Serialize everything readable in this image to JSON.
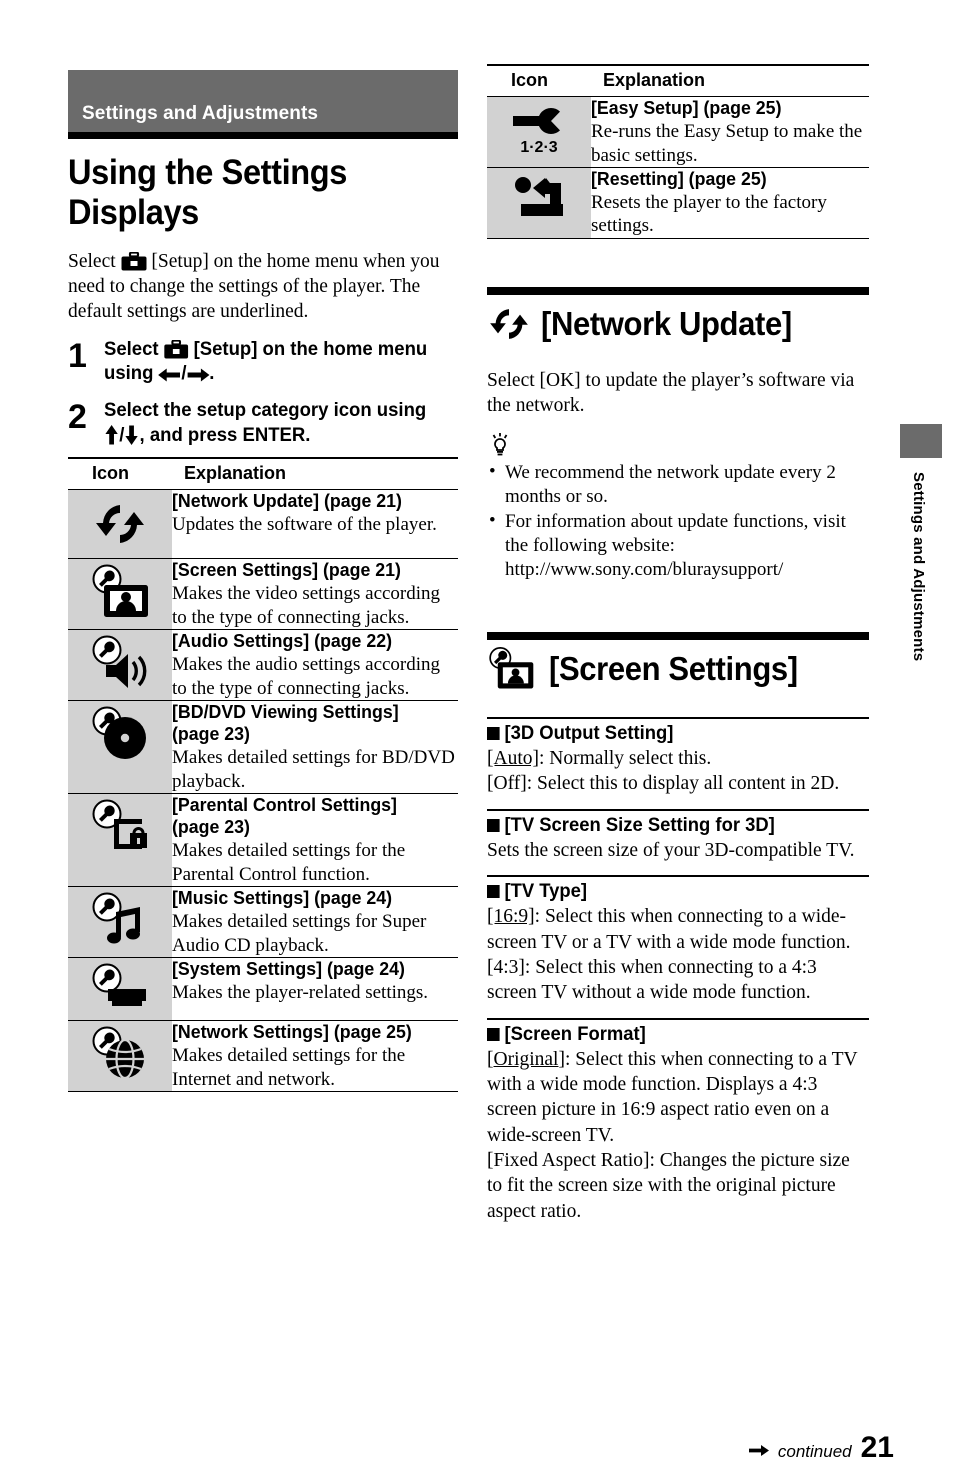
{
  "chapter": {
    "label": "Settings and Adjustments"
  },
  "headline": "Using the Settings Displays",
  "intro": {
    "before_icon": "Select",
    "after_icon": "[Setup] on the home menu when you need to change the settings of the player. The default settings are underlined."
  },
  "steps": [
    {
      "num": "1",
      "before_icon": "Select",
      "after_icon": "[Setup] on the home menu using",
      "after_arrows": "."
    },
    {
      "num": "2",
      "before_icon": "Select the setup category icon using",
      "after_arrows": ", and press ENTER."
    }
  ],
  "table": {
    "headers": {
      "icon": "Icon",
      "explanation": "Explanation"
    },
    "left_rows": [
      {
        "icon": "network-update-icon",
        "title": "[Network Update] (page 21)",
        "desc": "Updates the software of the player."
      },
      {
        "icon": "screen-settings-icon",
        "title": "[Screen Settings] (page 21)",
        "desc": "Makes the video settings according to the type of connecting jacks."
      },
      {
        "icon": "audio-settings-icon",
        "title": "[Audio Settings] (page 22)",
        "desc": "Makes the audio settings according to the type of connecting jacks."
      },
      {
        "icon": "bd-dvd-viewing-settings-icon",
        "title": "[BD/DVD Viewing Settings] (page 23)",
        "desc": "Makes detailed settings for BD/DVD playback."
      },
      {
        "icon": "parental-control-settings-icon",
        "title": "[Parental Control Settings] (page 23)",
        "desc": "Makes detailed settings for the Parental Control function."
      },
      {
        "icon": "music-settings-icon",
        "title": "[Music Settings] (page 24)",
        "desc": "Makes detailed settings for Super Audio CD playback."
      },
      {
        "icon": "system-settings-icon",
        "title": "[System Settings] (page 24)",
        "desc": "Makes the player-related settings."
      },
      {
        "icon": "network-settings-icon",
        "title": "[Network Settings] (page 25)",
        "desc": "Makes detailed settings for the Internet and network."
      }
    ],
    "right_rows": [
      {
        "icon": "easy-setup-icon",
        "title": "[Easy Setup] (page 25)",
        "desc": "Re-runs the Easy Setup to make the basic settings."
      },
      {
        "icon": "resetting-icon",
        "title": "[Resetting] (page 25)",
        "desc": "Resets the player to the factory settings."
      }
    ]
  },
  "network_update": {
    "title": "[Network Update]",
    "icon": "network-update-icon",
    "body": "Select [OK] to update the player’s software via the network.",
    "tips": [
      "We recommend the network update every 2 months or so.",
      "For information about update functions, visit the following website:",
      "http://www.sony.com/bluraysupport/"
    ]
  },
  "screen_settings": {
    "title": "[Screen Settings]",
    "icon": "screen-settings-icon",
    "subsections": [
      {
        "head": "[3D Output Setting]",
        "lines": [
          {
            "option": "[Auto]",
            "underline": true,
            "text": ": Normally select this."
          },
          {
            "option": "[Off]",
            "underline": false,
            "text": ": Select this to display all content in 2D."
          }
        ]
      },
      {
        "head": "[TV Screen Size Setting for 3D]",
        "lines": [
          {
            "option": "",
            "underline": false,
            "text": "Sets the screen size of your 3D-compatible TV."
          }
        ]
      },
      {
        "head": "[TV Type]",
        "lines": [
          {
            "option": "[16:9]",
            "underline": true,
            "text": ": Select this when connecting to a wide-screen TV or a TV with a wide mode function."
          },
          {
            "option": "[4:3]",
            "underline": false,
            "text": ": Select this when connecting to a 4:3 screen TV without a wide mode function."
          }
        ]
      },
      {
        "head": "[Screen Format]",
        "lines": [
          {
            "option": "[Original]",
            "underline": true,
            "text": ": Select this when connecting to a TV with a wide mode function. Displays a 4:3 screen picture in 16:9 aspect ratio even on a wide-screen TV."
          },
          {
            "option": "[Fixed Aspect Ratio]",
            "underline": false,
            "text": ": Changes the picture size to fit the screen size with the original picture aspect ratio."
          }
        ]
      }
    ]
  },
  "sidetab": {
    "label": "Settings and Adjustments"
  },
  "footer": {
    "continued": "continued",
    "page_number": "21"
  },
  "colors": {
    "chapter_bar": "#6b6b6b",
    "icon_cell": "#d2d2d2",
    "rule": "#000000"
  }
}
